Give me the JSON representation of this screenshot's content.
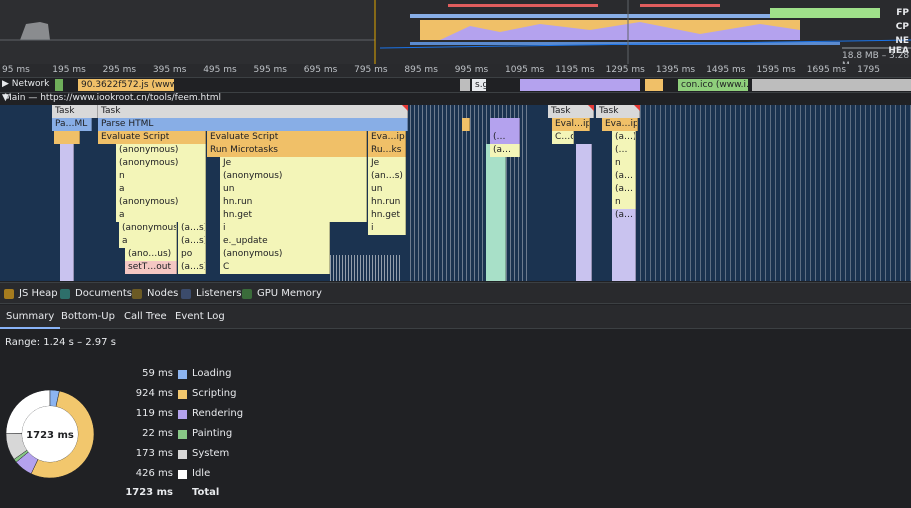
{
  "overview": {
    "labels": [
      "FP",
      "CP",
      "NE",
      "HEA"
    ],
    "heap_readout": "18.8 MB – 3.28 M"
  },
  "ruler": [
    "95 ms",
    "195 ms",
    "295 ms",
    "395 ms",
    "495 ms",
    "595 ms",
    "695 ms",
    "795 ms",
    "895 ms",
    "995 ms",
    "1095 ms",
    "1195 ms",
    "1295 ms",
    "1395 ms",
    "1495 ms",
    "1595 ms",
    "1695 ms",
    "1795"
  ],
  "network": {
    "label": "Network",
    "requests": [
      "90.3622f572.js (www…",
      "s.g",
      "con.ico (www.i…"
    ]
  },
  "main": {
    "label": "Main — https://www.iookroot.cn/tools/feem.html",
    "blocks": {
      "task1": "Task",
      "task2": "Task",
      "task3": "Task",
      "task4": "Task",
      "pa_ml": "Pa…ML",
      "parse_html": "Parse HTML",
      "eval1": "Evaluate Script",
      "eval2": "Evaluate Script",
      "eval3": "Eva…ipt",
      "eval4": "Eval…ipt",
      "eval5": "Eva…ipt",
      "anon1": "(anonymous)",
      "run_micro": "Run Microtasks",
      "ru_ks": "Ru…ks",
      "c_ct": "C…ct",
      "a_1": "(a…)",
      "anon2": "(anonymous)",
      "je1": "Je",
      "je2": "Je",
      "n1": "n",
      "anon3": "(anonymous)",
      "an_s": "(an…s)",
      "a2": "a",
      "un1": "un",
      "un2": "un",
      "a3": "a",
      "anon4": "(anonymous)",
      "hn_run1": "hn.run",
      "hn_run2": "hn.run",
      "a4": "a",
      "hn_get1": "hn.get",
      "hn_get2": "hn.get",
      "anon5": "(anonymous)",
      "as1": "(a…s)",
      "i1": "i",
      "i2": "i",
      "a5": "a",
      "as2": "(a…s)",
      "e_update": "e._update",
      "ano_us": "(ano…us)",
      "po": "po",
      "anon6": "(anonymous)",
      "set_out": "setT…out",
      "as3": "(a…s)",
      "c1": "C",
      "side_a1": "(…",
      "side_a2": "(…",
      "side_n1": "n",
      "side_n2": "n",
      "side_a3": "(a…",
      "side_a4": "(a…",
      "side_a5": "(a…",
      "side_a6": "(a…"
    }
  },
  "memory": {
    "items": [
      {
        "label": "JS Heap",
        "color": "#a67c1e"
      },
      {
        "label": "Documents",
        "color": "#2e6f6a"
      },
      {
        "label": "Nodes",
        "color": "#6b5a24"
      },
      {
        "label": "Listeners",
        "color": "#3b4b6b"
      },
      {
        "label": "GPU Memory",
        "color": "#3a6b3a"
      }
    ]
  },
  "tabs": [
    "Summary",
    "Bottom-Up",
    "Call Tree",
    "Event Log"
  ],
  "summary": {
    "range": "Range: 1.24 s – 2.97 s",
    "total_center": "1723 ms",
    "rows": [
      {
        "ms": "59 ms",
        "name": "Loading",
        "color": "#8cb4f0"
      },
      {
        "ms": "924 ms",
        "name": "Scripting",
        "color": "#f2c76d"
      },
      {
        "ms": "119 ms",
        "name": "Rendering",
        "color": "#b4a2ee"
      },
      {
        "ms": "22 ms",
        "name": "Painting",
        "color": "#88c886"
      },
      {
        "ms": "173 ms",
        "name": "System",
        "color": "#d7d7d7"
      },
      {
        "ms": "426 ms",
        "name": "Idle",
        "color": "#ffffff"
      }
    ],
    "total_ms": "1723 ms",
    "total_label": "Total"
  }
}
